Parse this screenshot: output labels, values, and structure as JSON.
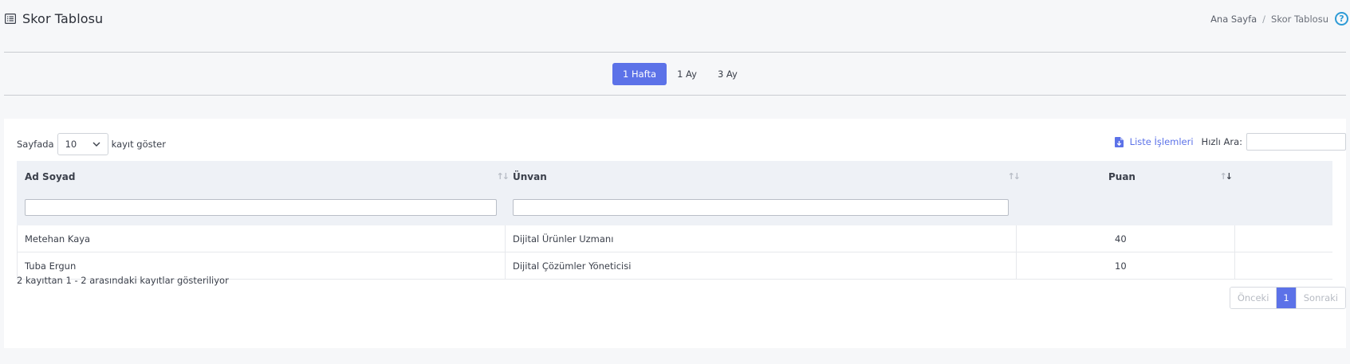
{
  "page": {
    "title": "Skor Tablosu",
    "icon": "list-icon"
  },
  "breadcrumb": {
    "home": "Ana Sayfa",
    "separator": "/",
    "current": "Skor Tablosu",
    "help_icon": "?"
  },
  "period_tabs": [
    {
      "label": "1 Hafta",
      "active": true
    },
    {
      "label": "1 Ay",
      "active": false
    },
    {
      "label": "3 Ay",
      "active": false
    }
  ],
  "controls": {
    "page_size_prefix": "Sayfada",
    "page_size_value": "10",
    "page_size_suffix": "kayıt göster",
    "list_ops_label": "Liste İşlemleri",
    "quick_search_label": "Hızlı Ara:",
    "quick_search_value": ""
  },
  "table": {
    "columns": [
      {
        "label": "Ad Soyad",
        "sort": "none"
      },
      {
        "label": "Ünvan",
        "sort": "none"
      },
      {
        "label": "Puan",
        "sort": "desc"
      }
    ],
    "rows": [
      {
        "name": "Metehan Kaya",
        "title": "Dijital Ürünler Uzmanı",
        "score": "40"
      },
      {
        "name": "Tuba Ergun",
        "title": "Dijital Çözümler Yöneticisi",
        "score": "10"
      }
    ]
  },
  "footer": {
    "info": "2 kayıttan 1 - 2 arasındaki kayıtlar gösteriliyor",
    "prev": "Önceki",
    "current_page": "1",
    "next": "Sonraki"
  },
  "colors": {
    "accent": "#5c72e8",
    "help": "#2e9bd6",
    "header_bg": "#eef1f6"
  }
}
